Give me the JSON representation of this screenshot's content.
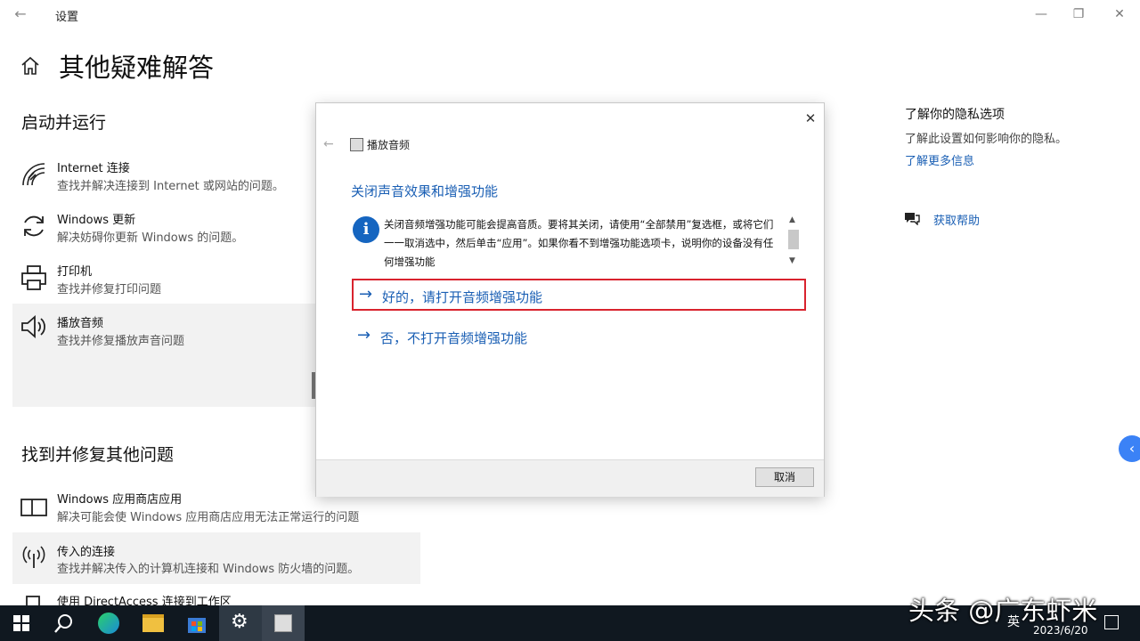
{
  "window": {
    "title": "设置"
  },
  "page": {
    "title": "其他疑难解答"
  },
  "sections": {
    "startup": {
      "heading": "启动并运行",
      "items": [
        {
          "icon": "wifi-icon",
          "title": "Internet 连接",
          "desc": "查找并解决连接到 Internet 或网站的问题。"
        },
        {
          "icon": "refresh-icon",
          "title": "Windows 更新",
          "desc": "解决妨碍你更新 Windows 的问题。"
        },
        {
          "icon": "printer-icon",
          "title": "打印机",
          "desc": "查找并修复打印问题"
        },
        {
          "icon": "speaker-icon",
          "title": "播放音频",
          "desc": "查找并修复播放声音问题"
        }
      ]
    },
    "other": {
      "heading": "找到并修复其他问题",
      "items": [
        {
          "icon": "store-app-icon",
          "title": "Windows 应用商店应用",
          "desc": "解决可能会使 Windows 应用商店应用无法正常运行的问题"
        },
        {
          "icon": "antenna-icon",
          "title": "传入的连接",
          "desc": "查找并解决传入的计算机连接和 Windows 防火墙的问题。"
        },
        {
          "icon": "device-icon",
          "title": "使用 DirectAccess 连接到工作区",
          "desc": ""
        }
      ]
    }
  },
  "right_panel": {
    "privacy_title": "了解你的隐私选项",
    "privacy_desc": "了解此设置如何影响你的隐私。",
    "learn_more": "了解更多信息",
    "get_help": "获取帮助"
  },
  "dialog": {
    "app_title": "播放音频",
    "heading": "关闭声音效果和增强功能",
    "info_text": "关闭音频增强功能可能会提高音质。要将其关闭，请使用“全部禁用”复选框，或将它们一一取消选中，然后单击“应用”。如果你看不到增强功能选项卡，说明你的设备没有任何增强功能",
    "option_yes": "好的，请打开音频增强功能",
    "option_no": "否，不打开音频增强功能",
    "cancel": "取消"
  },
  "taskbar": {
    "lang": "英",
    "date": "2023/6/20"
  },
  "watermark": "头条 @广东虾米",
  "colors": {
    "accent": "#1a5fb4",
    "highlight": "#d9232e",
    "taskbar": "#101820"
  }
}
